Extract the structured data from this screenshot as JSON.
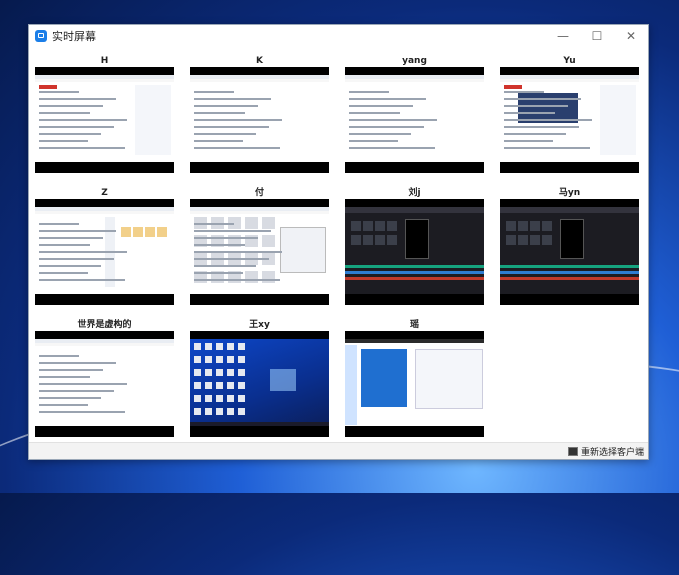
{
  "window": {
    "title": "实时屏幕"
  },
  "controls": {
    "minimize": "—",
    "maximize": "☐",
    "close": "✕"
  },
  "clients": [
    {
      "name": "H",
      "theme": "web"
    },
    {
      "name": "K",
      "theme": "doc"
    },
    {
      "name": "yang",
      "theme": "doc"
    },
    {
      "name": "Yu",
      "theme": "web-photo"
    },
    {
      "name": "Z",
      "theme": "files"
    },
    {
      "name": "付",
      "theme": "thumbs"
    },
    {
      "name": "刘j",
      "theme": "video-dark"
    },
    {
      "name": "马yn",
      "theme": "video-dark"
    },
    {
      "name": "世界是虚构的",
      "theme": "doc"
    },
    {
      "name": "王xy",
      "theme": "desktop"
    },
    {
      "name": "瑶",
      "theme": "web-banner"
    }
  ],
  "footer": {
    "reselect_label": "重新选择客户端"
  },
  "colors": {
    "desktop_blue": "#1f5fd6",
    "video_dark": "#1c1c22",
    "banner_blue": "#1f6fd0"
  }
}
